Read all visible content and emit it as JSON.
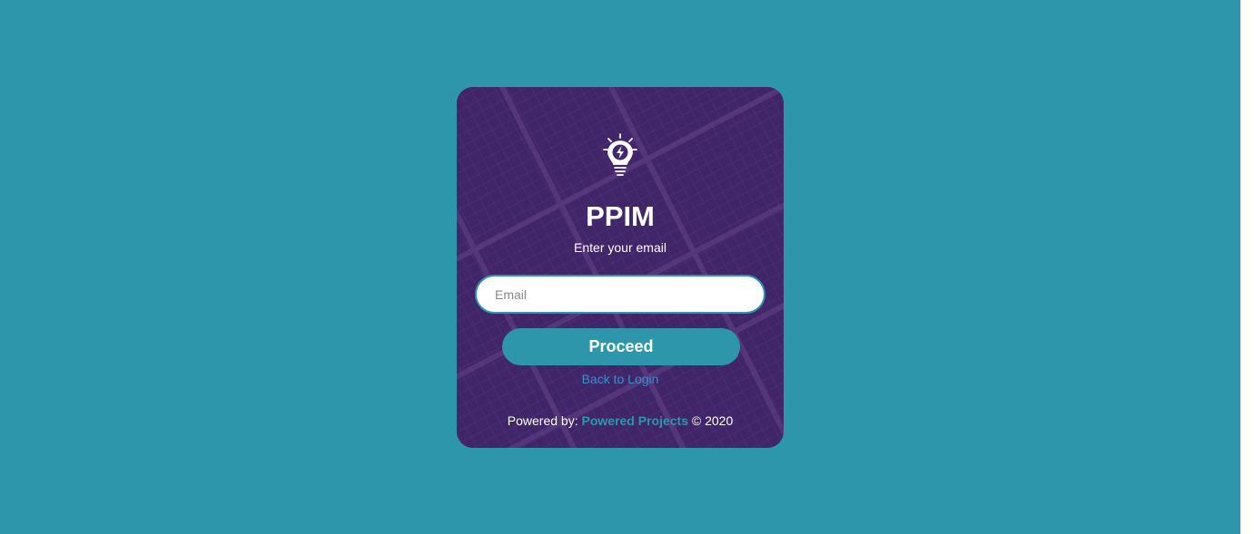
{
  "colors": {
    "page_background": "#2e96aa",
    "card_background": "#3e2466",
    "accent": "#2e96aa",
    "link": "#3a8fd0"
  },
  "card": {
    "logo_icon": "lightbulb-bolt-icon",
    "title": "PPIM",
    "subtitle": "Enter your email",
    "email": {
      "placeholder": "Email",
      "value": ""
    },
    "proceed_label": "Proceed",
    "back_link_label": "Back to Login",
    "footer": {
      "prefix": "Powered by:",
      "brand": "Powered Projects",
      "suffix": "© 2020"
    }
  }
}
